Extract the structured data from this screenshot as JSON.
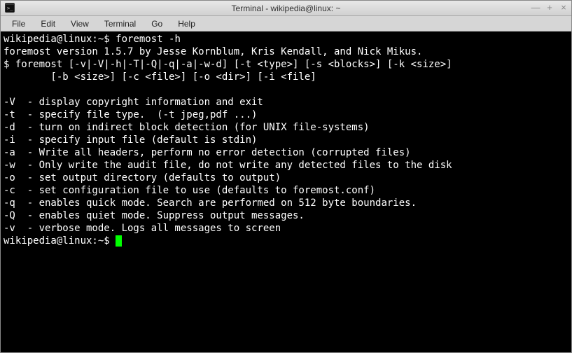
{
  "window": {
    "title": "Terminal - wikipedia@linux: ~"
  },
  "menubar": {
    "items": [
      "File",
      "Edit",
      "View",
      "Terminal",
      "Go",
      "Help"
    ]
  },
  "terminal": {
    "prompt1": "wikipedia@linux:~$ ",
    "command1": "foremost -h",
    "output": [
      "foremost version 1.5.7 by Jesse Kornblum, Kris Kendall, and Nick Mikus.",
      "$ foremost [-v|-V|-h|-T|-Q|-q|-a|-w-d] [-t <type>] [-s <blocks>] [-k <size>]",
      "        [-b <size>] [-c <file>] [-o <dir>] [-i <file]",
      "",
      "-V  - display copyright information and exit",
      "-t  - specify file type.  (-t jpeg,pdf ...)",
      "-d  - turn on indirect block detection (for UNIX file-systems)",
      "-i  - specify input file (default is stdin)",
      "-a  - Write all headers, perform no error detection (corrupted files)",
      "-w  - Only write the audit file, do not write any detected files to the disk",
      "-o  - set output directory (defaults to output)",
      "-c  - set configuration file to use (defaults to foremost.conf)",
      "-q  - enables quick mode. Search are performed on 512 byte boundaries.",
      "-Q  - enables quiet mode. Suppress output messages.",
      "-v  - verbose mode. Logs all messages to screen"
    ],
    "prompt2": "wikipedia@linux:~$ "
  }
}
